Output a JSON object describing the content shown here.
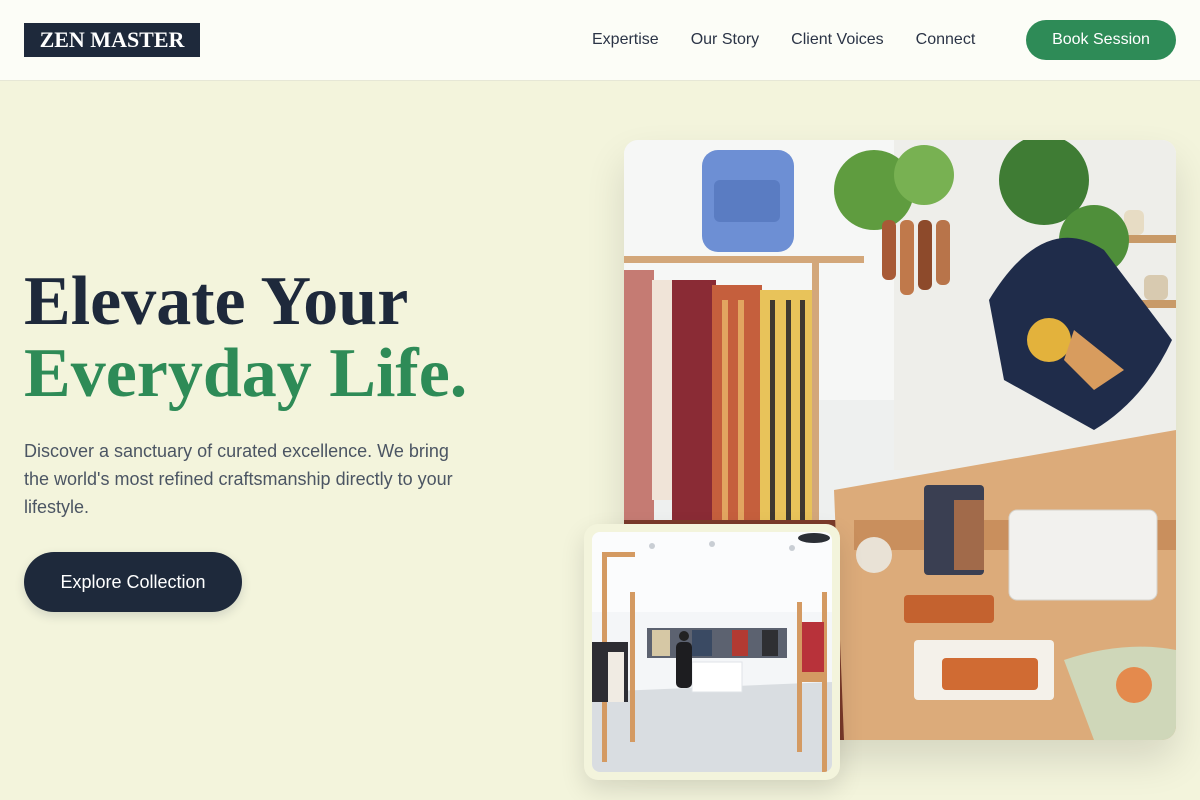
{
  "brand": {
    "logo": "ZEN MASTER"
  },
  "nav": {
    "links": [
      "Expertise",
      "Our Story",
      "Client Voices",
      "Connect"
    ],
    "cta": "Book Session"
  },
  "hero": {
    "title_line1": "Elevate Your",
    "title_line2": "Everyday Life.",
    "description": "Discover a sanctuary of curated excellence. We bring the world's most refined craftsmanship directly to your lifestyle.",
    "cta": "Explore Collection"
  },
  "colors": {
    "background": "#f3f4dc",
    "navy": "#1e293b",
    "green": "#2e8b57"
  }
}
